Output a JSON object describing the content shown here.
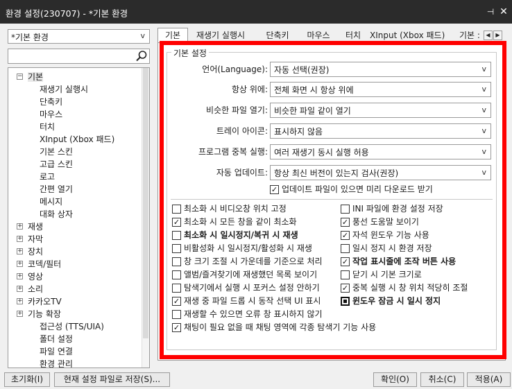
{
  "window": {
    "title": "환경 설정(230707) - *기본 환경",
    "pin_icon": "pin-icon",
    "close_icon": "close-icon"
  },
  "preset": {
    "value": "*기본 환경"
  },
  "search": {
    "value": "",
    "icon": "search-icon"
  },
  "tree": [
    {
      "label": "기본",
      "expander": "−",
      "selected": true
    },
    {
      "label": "재생기 실행시"
    },
    {
      "label": "단축키"
    },
    {
      "label": "마우스"
    },
    {
      "label": "터치"
    },
    {
      "label": "XInput (Xbox 패드)"
    },
    {
      "label": "기본 스킨"
    },
    {
      "label": "고급 스킨"
    },
    {
      "label": "로고"
    },
    {
      "label": "간편 열기"
    },
    {
      "label": "메시지"
    },
    {
      "label": "대화 상자"
    },
    {
      "label": "재생",
      "expander": "+"
    },
    {
      "label": "자막",
      "expander": "+"
    },
    {
      "label": "장치",
      "expander": "+"
    },
    {
      "label": "코덱/필터",
      "expander": "+"
    },
    {
      "label": "영상",
      "expander": "+"
    },
    {
      "label": "소리",
      "expander": "+"
    },
    {
      "label": "카카오TV",
      "expander": "+"
    },
    {
      "label": "기능 확장",
      "expander": "+"
    },
    {
      "label": "접근성 (TTS/UIA)"
    },
    {
      "label": "폴더 설정"
    },
    {
      "label": "파일 연결"
    },
    {
      "label": "환경 관리"
    }
  ],
  "tabs": [
    "기본",
    "재생기 실행시",
    "단축키",
    "마우스",
    "터치",
    "XInput (Xbox 패드)",
    "기본 :"
  ],
  "tab_arrows": [
    "◀",
    "▶"
  ],
  "group_title": "기본 설정",
  "settings": [
    {
      "label": "언어(Language):",
      "value": "자동 선택(권장)"
    },
    {
      "label": "항상 위에:",
      "value": "전체 화면 시 항상 위에"
    },
    {
      "label": "비슷한 파일 열기:",
      "value": "비슷한 파일 같이 열기"
    },
    {
      "label": "트레이 아이콘:",
      "value": "표시하지 않음"
    },
    {
      "label": "프로그램 중복 실행:",
      "value": "여러 재생기 동시 실행 허용"
    },
    {
      "label": "자동 업데이트:",
      "value": "항상 최신 버전이 있는지 검사(권장)"
    }
  ],
  "dropdown_chevron": "v",
  "update_checkbox": {
    "label": "업데이트 파일이 있으면 미리 다운로드 받기",
    "checked": true
  },
  "checkboxes_left": [
    {
      "label": "최소화 시 비디오창 위치 고정",
      "checked": false,
      "bold": false
    },
    {
      "label": "최소화 시 모든 창을 같이 최소화",
      "checked": true,
      "bold": false
    },
    {
      "label": "최소화 시 일시정지/복귀 시 재생",
      "checked": false,
      "bold": true
    },
    {
      "label": "비활성화 시 일시정지/활성화 시 재생",
      "checked": false,
      "bold": false
    },
    {
      "label": "창 크기 조절 시 가운데를 기준으로 처리",
      "checked": false,
      "bold": false
    },
    {
      "label": "앨범/즐겨찾기에 재생했던 목록 보이기",
      "checked": false,
      "bold": false
    },
    {
      "label": "탐색기에서 실행 시 포커스 설정 안하기",
      "checked": false,
      "bold": false
    },
    {
      "label": "재생 중 파일 드롭 시 동작 선택 UI 표시",
      "checked": true,
      "bold": false
    },
    {
      "label": "재생할 수 있으면 오류 창 표시하지 않기",
      "checked": false,
      "bold": false
    },
    {
      "label": "채팅이 필요 없을 때 채팅 영역에 각종 탐색기 기능 사용",
      "checked": true,
      "bold": false
    }
  ],
  "checkboxes_right": [
    {
      "label": "INI 파일에 환경 설정 저장",
      "checked": false,
      "bold": false,
      "filled": false
    },
    {
      "label": "풍선 도움말 보이기",
      "checked": true,
      "bold": false,
      "filled": false
    },
    {
      "label": "자석 윈도우 기능 사용",
      "checked": true,
      "bold": false,
      "filled": false
    },
    {
      "label": "일시 정지 시 환경 저장",
      "checked": false,
      "bold": false,
      "filled": false
    },
    {
      "label": "작업 표시줄에 조작 버튼 사용",
      "checked": true,
      "bold": true,
      "filled": false
    },
    {
      "label": "닫기 시 기본 크기로",
      "checked": false,
      "bold": false,
      "filled": false
    },
    {
      "label": "중복 실행 시 창 위치 적당히 조절",
      "checked": true,
      "bold": false,
      "filled": false
    },
    {
      "label": "윈도우 잠금 시 일시 정지",
      "checked": false,
      "bold": true,
      "filled": true
    }
  ],
  "check_mark": "✓",
  "buttons": {
    "reset": "초기화(I)",
    "save_file": "현재 설정 파일로 저장(S)...",
    "ok": "확인(O)",
    "cancel": "취소(C)",
    "apply": "적용(A)"
  }
}
